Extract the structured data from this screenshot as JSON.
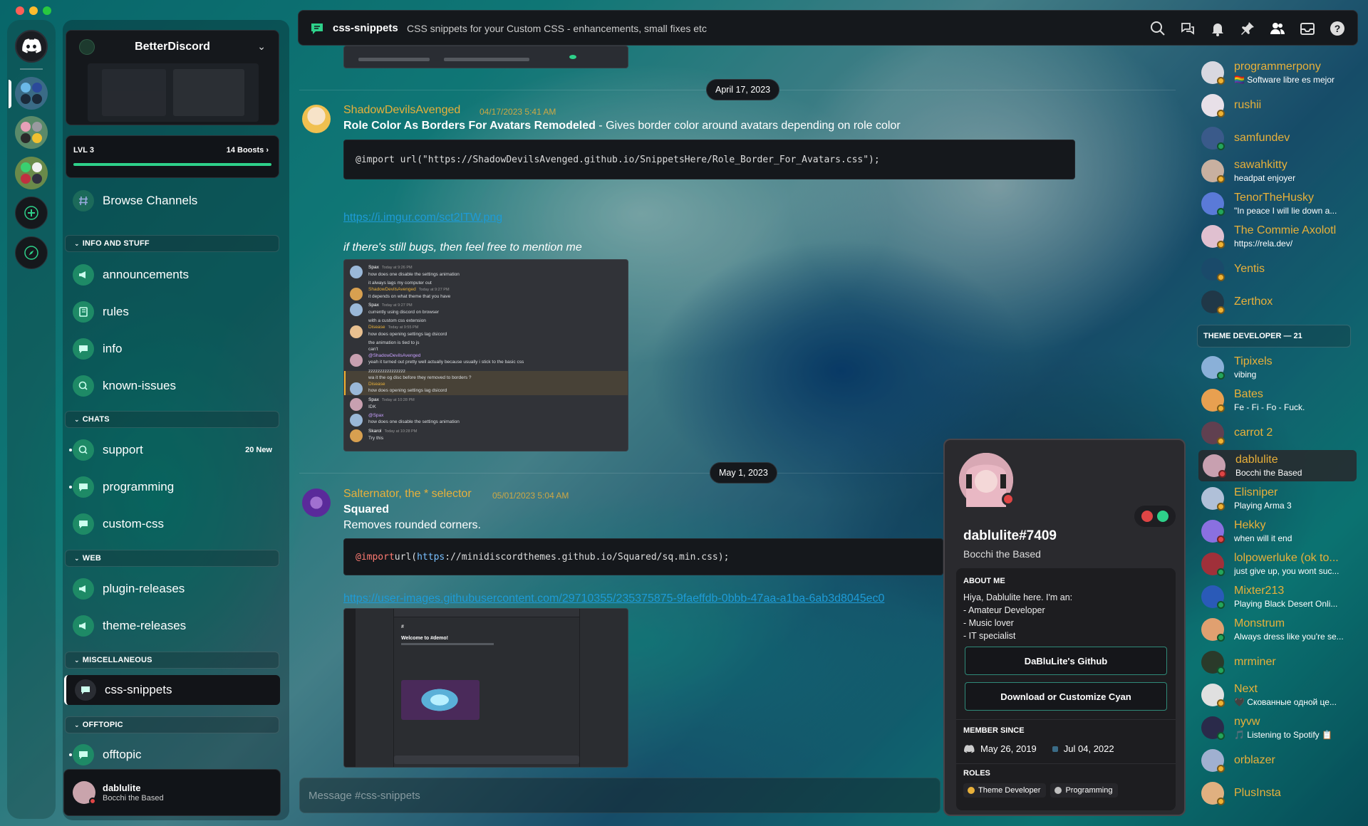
{
  "guild": {
    "name": "BetterDiscord",
    "level": "LVL 3",
    "boosts": "14 Boosts ›"
  },
  "sidebar": {
    "browse": "Browse Channels",
    "categories": [
      "INFO AND STUFF",
      "CHATS",
      "WEB",
      "MISCELLANEOUS",
      "OFFTOPIC"
    ],
    "channels": {
      "announcements": "announcements",
      "rules": "rules",
      "info": "info",
      "known_issues": "known-issues",
      "support": "support",
      "support_badge": "20 New",
      "programming": "programming",
      "custom_css": "custom-css",
      "plugin_releases": "plugin-releases",
      "theme_releases": "theme-releases",
      "css_snippets": "css-snippets",
      "offtopic": "offtopic"
    }
  },
  "user_panel": {
    "name": "dablulite",
    "status": "Bocchi the Based"
  },
  "header": {
    "channel": "css-snippets",
    "topic": "CSS snippets for your Custom CSS - enhancements, small fixes etc",
    "icons": [
      "search-icon",
      "threads-icon",
      "bell-icon",
      "pin-icon",
      "members-icon",
      "inbox-icon",
      "help-icon"
    ]
  },
  "messages": {
    "date1": "April 17, 2023",
    "m1": {
      "author": "ShadowDevilsAvenged",
      "time": "04/17/2023 5:41 AM",
      "title": "Role Color As Borders For Avatars Remodeled",
      "desc": " - Gives border color around avatars depending on role color",
      "code": "@import url(\"https://ShadowDevilsAvenged.github.io/SnippetsHere/Role_Border_For_Avatars.css\");",
      "link": "https://i.imgur.com/sct2ITW.png",
      "italic": "if there's still bugs, then feel free to mention me"
    },
    "date2": "May 1, 2023",
    "m2": {
      "author": "Salternator, the * selector",
      "time": "05/01/2023 5:04 AM",
      "title": "Squared",
      "desc": "Removes rounded corners.",
      "code_kw": "@import",
      "code_fn": " url(",
      "code_url": "https",
      "code_rest": "://minidiscordthemes.github.io/Squared/sq.min.css);",
      "link": "https://user-images.githubusercontent.com/29710355/235375875-9faeffdb-0bbb-47aa-a1ba-6ab3d8045ec0"
    },
    "embed_chat": [
      {
        "name": "Spax",
        "time": "Today at 9:26 PM",
        "text": "how does one disable the settings animation"
      },
      {
        "name": "",
        "time": "",
        "text": "it always lags my computer out"
      },
      {
        "name": "ShadowDevilsAvenged",
        "time": "Today at 9:27 PM",
        "text": "it depends on what theme that you have"
      },
      {
        "name": "Spax",
        "time": "Today at 9:27 PM",
        "text": "currently using discord on browser"
      },
      {
        "name": "",
        "time": "",
        "text": "with a custom css extension"
      },
      {
        "name": "Disease",
        "time": "Today at 9:55 PM",
        "text": "how does opening settings lag dsicord"
      },
      {
        "name": "",
        "time": "",
        "text": "the animation is tied to js"
      },
      {
        "name": "",
        "time": "",
        "text": "can't"
      },
      {
        "name": "@ShadowDevilsAvenged",
        "time": "",
        "text": "yeah it turned out pretty well actually because usually i stick to the basic css"
      },
      {
        "name": "",
        "time": "",
        "text": "zzzzzzzzzzzzzzzz"
      },
      {
        "name": "",
        "time": "",
        "text": "wa it the og disc before they removed to borders ?"
      },
      {
        "name": "Disease",
        "time": "",
        "text": "how does opening settings lag dsicord"
      },
      {
        "name": "Spax",
        "time": "Today at 10:28 PM",
        "text": "IDK"
      },
      {
        "name": "@Spax",
        "time": "",
        "text": "how does one disable the settings animation"
      },
      {
        "name": "Skarol",
        "time": "Today at 10:28 PM",
        "text": "Try this"
      }
    ],
    "embed2": {
      "heading": "Welcome to #demo!"
    }
  },
  "composer": {
    "placeholder": "Message #css-snippets"
  },
  "members": {
    "top": [
      {
        "name": "programmerpony",
        "activity": "🏳️‍🌈 Software libre es mejor",
        "status": "#f0b232"
      },
      {
        "name": "rushii",
        "activity": "",
        "status": "#f0b232"
      },
      {
        "name": "samfundev",
        "activity": "",
        "status": "#23a55a"
      },
      {
        "name": "sawahkitty",
        "activity": "headpat enjoyer",
        "status": "#f0b232"
      },
      {
        "name": "TenorTheHusky",
        "activity": "\"In peace I will lie down a...",
        "status": "#23a55a"
      },
      {
        "name": "The Commie Axolotl",
        "activity": "https://rela.dev/",
        "status": "#f0b232"
      },
      {
        "name": "Yentis",
        "activity": "",
        "status": "#f0b232"
      },
      {
        "name": "Zerthox",
        "activity": "",
        "status": "#f0b232"
      }
    ],
    "role_category": "THEME DEVELOPER — 21",
    "theme_devs": [
      {
        "name": "Tipixels",
        "activity": "vibing",
        "status": "#23a55a"
      },
      {
        "name": "Bates",
        "activity": "Fe - Fi - Fo - Fuck.",
        "status": "#f0b232"
      },
      {
        "name": "carrot 2",
        "activity": "",
        "status": "#f0b232"
      },
      {
        "name": "dablulite",
        "activity": "Bocchi the Based",
        "status": "#e04545"
      },
      {
        "name": "Elisniper",
        "activity": "Playing Arma 3",
        "status": "#f0b232"
      },
      {
        "name": "Hekky",
        "activity": "when will it end",
        "status": "#e04545"
      },
      {
        "name": "lolpowerluke (ok to...",
        "activity": "just give up, you wont suc...",
        "status": "#23a55a"
      },
      {
        "name": "Mixter213",
        "activity": "Playing Black Desert Onli...",
        "status": "#23a55a"
      },
      {
        "name": "Monstrum",
        "activity": "Always dress like you're se...",
        "status": "#23a55a"
      },
      {
        "name": "mrminer",
        "activity": "",
        "status": "#23a55a"
      },
      {
        "name": "Next",
        "activity": "🖤 Скованные одной це...",
        "status": "#f0b232"
      },
      {
        "name": "nyvw",
        "activity": "🎵 Listening to Spotify 📋",
        "status": "#23a55a"
      },
      {
        "name": "orblazer",
        "activity": "",
        "status": "#f0b232"
      },
      {
        "name": "PlusInsta",
        "activity": "",
        "status": "#f0b232"
      }
    ]
  },
  "profile": {
    "tag": "dablulite#7409",
    "status": "Bocchi the Based",
    "about_heading": "ABOUT ME",
    "about_lines": [
      "Hiya, Dablulite here. I'm an:",
      "- Amateur Developer",
      "- Music lover",
      "- IT specialist"
    ],
    "btn1": "DaBluLite's Github",
    "btn2": "Download or Customize Cyan",
    "member_since_heading": "MEMBER SINCE",
    "discord_since": "May 26, 2019",
    "server_since": "Jul 04, 2022",
    "roles_heading": "ROLES",
    "roles": [
      {
        "name": "Theme Developer",
        "color": "#e8b03a"
      },
      {
        "name": "Programming",
        "color": "#bfbfbf"
      }
    ]
  },
  "colors": {
    "accent": "#2ed18a",
    "author": "#e8b03a",
    "link": "#1e9bd7"
  }
}
